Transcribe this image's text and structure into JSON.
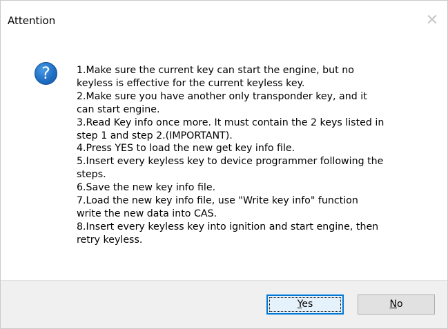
{
  "dialog": {
    "title": "Attention",
    "close_glyph": "✕",
    "icon": "question-icon",
    "icon_glyph": "?",
    "icon_color": "#1f6fc4",
    "message_lines": [
      "1.Make sure the current key can start the engine, but no",
      "keyless is effective for the current keyless key.",
      "2.Make sure you have another only transponder key, and it",
      "can start engine.",
      "3.Read Key info once more. It must contain the 2 keys listed in",
      "step 1 and step 2.(IMPORTANT).",
      "4.Press YES to load the new get key info file.",
      "5.Insert every keyless key to device programmer following the",
      "steps.",
      "6.Save the new key info file.",
      "7.Load the new key info file, use \"Write key info\" function",
      "write the new data into CAS.",
      "8.Insert every keyless key into ignition and start engine, then",
      "retry keyless."
    ],
    "buttons": {
      "yes": {
        "label": "Yes",
        "underline_char": "Y",
        "rest": "es"
      },
      "no": {
        "label": "No",
        "underline_char": "N",
        "rest": "o"
      }
    },
    "accent_color": "#0078d7"
  }
}
